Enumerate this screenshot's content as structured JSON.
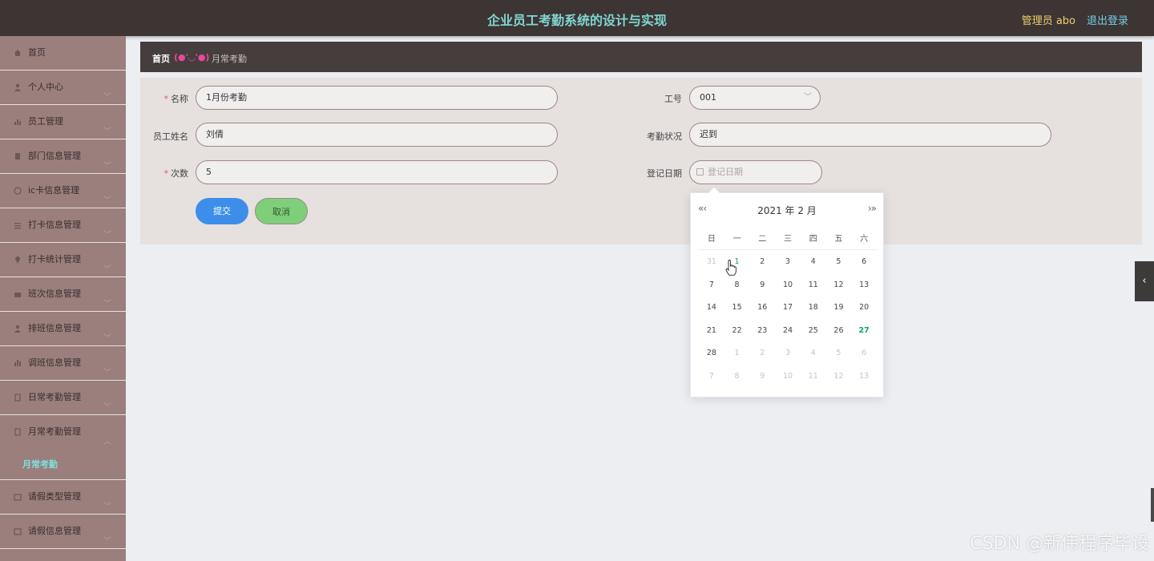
{
  "header": {
    "title": "企业员工考勤系统的设计与实现",
    "user": "管理员 abo",
    "logout": "退出登录"
  },
  "sidebar": {
    "items": [
      {
        "label": "首页",
        "icon": "home-icon"
      },
      {
        "label": "个人中心",
        "icon": "user-icon"
      },
      {
        "label": "员工管理",
        "icon": "bar-chart-icon"
      },
      {
        "label": "部门信息管理",
        "icon": "clipboard-icon"
      },
      {
        "label": "ic卡信息管理",
        "icon": "clock-icon"
      },
      {
        "label": "打卡信息管理",
        "icon": "list-icon"
      },
      {
        "label": "打卡统计管理",
        "icon": "pin-icon"
      },
      {
        "label": "班次信息管理",
        "icon": "store-icon"
      },
      {
        "label": "排班信息管理",
        "icon": "person-icon"
      },
      {
        "label": "调班信息管理",
        "icon": "chart-icon"
      },
      {
        "label": "日常考勤管理",
        "icon": "doc-icon"
      },
      {
        "label": "月常考勤管理",
        "icon": "doc2-icon"
      }
    ],
    "sub_active": "月常考勤",
    "items_after": [
      {
        "label": "请假类型管理",
        "icon": "folder-icon"
      },
      {
        "label": "请假信息管理",
        "icon": "folder2-icon"
      }
    ]
  },
  "breadcrumb": {
    "home": "首页",
    "separator": "(●'◡'●)",
    "current": "月常考勤"
  },
  "form": {
    "name_label": "名称",
    "name_value": "1月份考勤",
    "empno_label": "工号",
    "empno_value": "001",
    "empname_label": "员工姓名",
    "empname_value": "刘倩",
    "status_label": "考勤状况",
    "status_value": "迟到",
    "count_label": "次数",
    "count_value": "5",
    "date_label": "登记日期",
    "date_placeholder": "登记日期",
    "submit": "提交",
    "cancel": "取消"
  },
  "datepicker": {
    "prev": "«‹",
    "next": "›»",
    "title": "2021 年  2 月",
    "weekdays": [
      "日",
      "一",
      "二",
      "三",
      "四",
      "五",
      "六"
    ],
    "rows": [
      [
        "31",
        "1",
        "2",
        "3",
        "4",
        "5",
        "6"
      ],
      [
        "7",
        "8",
        "9",
        "10",
        "11",
        "12",
        "13"
      ],
      [
        "14",
        "15",
        "16",
        "17",
        "18",
        "19",
        "20"
      ],
      [
        "21",
        "22",
        "23",
        "24",
        "25",
        "26",
        "27"
      ],
      [
        "28",
        "1",
        "2",
        "3",
        "4",
        "5",
        "6"
      ],
      [
        "7",
        "8",
        "9",
        "10",
        "11",
        "12",
        "13"
      ]
    ],
    "today": "27"
  },
  "watermark": "CSDN @新伟程序毕设",
  "colors": {
    "topbar": "#3d3434",
    "sidebar": "#9a7f7d",
    "title": "#7fd7d0",
    "submit": "#3c8eea",
    "cancel": "#7fcf7a",
    "today": "#14a06a"
  }
}
